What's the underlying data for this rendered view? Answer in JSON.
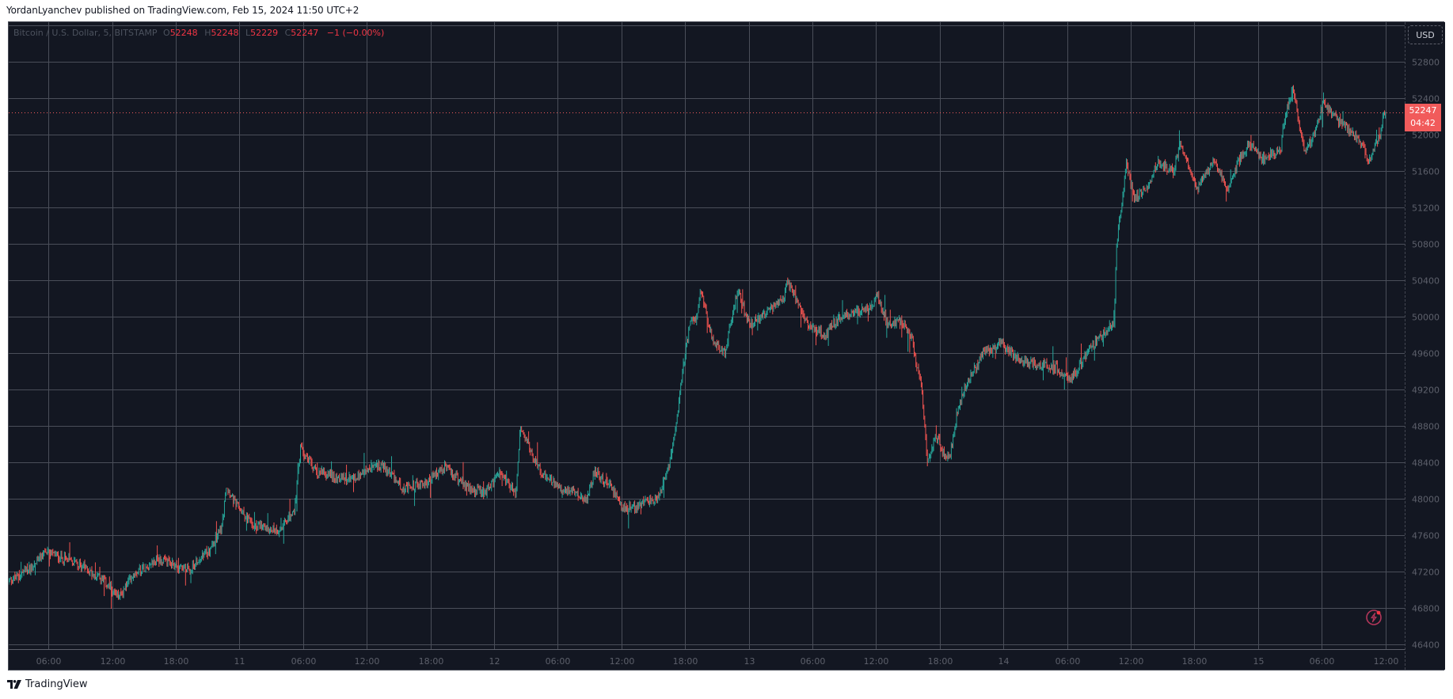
{
  "header": {
    "published_line": "YordanLyanchev published on TradingView.com, Feb 15, 2024 11:50 UTC+2"
  },
  "legend": {
    "symbol": "Bitcoin / U.S. Dollar, 5, BITSTAMP",
    "open_label": "O",
    "open": "52248",
    "high_label": "H",
    "high": "52248",
    "low_label": "L",
    "low": "52229",
    "close_label": "C",
    "close": "52247",
    "change": "−1 (−0.00%)"
  },
  "price_axis": {
    "currency_button": "USD",
    "last_price": "52247",
    "countdown": "04:42"
  },
  "footer": {
    "logo_glyph": "TV",
    "brand": "TradingView"
  },
  "icons": {
    "flash": "lightning-icon"
  },
  "colors": {
    "background": "#131722",
    "grid": "#4a4e59",
    "up": "#26a69a",
    "down": "#ef5350",
    "last_price": "#f15b5b",
    "axis_text": "#5d606b"
  },
  "chart_data": {
    "type": "candlestick",
    "title": "Bitcoin / U.S. Dollar, 5, BITSTAMP",
    "interval_minutes": 5,
    "start_time": "Feb 10 02:15",
    "hours_span": 107.8,
    "ylim": [
      46320,
      53300
    ],
    "y_ticks": [
      46400,
      46800,
      47200,
      47600,
      48000,
      48400,
      48800,
      49200,
      49600,
      50000,
      50400,
      50800,
      51200,
      51600,
      52000,
      52400,
      52800
    ],
    "x_ticks": [
      {
        "label": "06:00",
        "hours": 3.75
      },
      {
        "label": "12:00",
        "hours": 9.75
      },
      {
        "label": "18:00",
        "hours": 15.75
      },
      {
        "label": "11",
        "hours": 21.75
      },
      {
        "label": "06:00",
        "hours": 27.75
      },
      {
        "label": "12:00",
        "hours": 33.75
      },
      {
        "label": "18:00",
        "hours": 39.75
      },
      {
        "label": "12",
        "hours": 45.75
      },
      {
        "label": "06:00",
        "hours": 51.75
      },
      {
        "label": "12:00",
        "hours": 57.75
      },
      {
        "label": "18:00",
        "hours": 63.75
      },
      {
        "label": "13",
        "hours": 69.75
      },
      {
        "label": "06:00",
        "hours": 75.75
      },
      {
        "label": "12:00",
        "hours": 81.75
      },
      {
        "label": "18:00",
        "hours": 87.75
      },
      {
        "label": "14",
        "hours": 93.75
      },
      {
        "label": "06:00",
        "hours": 99.75
      },
      {
        "label": "12:00",
        "hours": 105.75
      },
      {
        "label": "18:00",
        "hours": 111.75
      },
      {
        "label": "15",
        "hours": 117.75
      },
      {
        "label": "06:00",
        "hours": 123.75
      },
      {
        "label": "12:00",
        "hours": 129.75
      }
    ],
    "price_path": [
      [
        0,
        47100
      ],
      [
        1.0,
        47150
      ],
      [
        2.6,
        47300
      ],
      [
        3.4,
        47420
      ],
      [
        6.7,
        47280
      ],
      [
        8.9,
        47100
      ],
      [
        10.4,
        46920
      ],
      [
        11.9,
        47200
      ],
      [
        14.1,
        47330
      ],
      [
        17.1,
        47220
      ],
      [
        19.0,
        47450
      ],
      [
        20.1,
        47700
      ],
      [
        20.5,
        48150
      ],
      [
        21.3,
        47950
      ],
      [
        23.1,
        47700
      ],
      [
        25.4,
        47650
      ],
      [
        26.9,
        47850
      ],
      [
        27.5,
        48550
      ],
      [
        29.1,
        48280
      ],
      [
        32.1,
        48200
      ],
      [
        35.1,
        48380
      ],
      [
        37.3,
        48100
      ],
      [
        39.6,
        48200
      ],
      [
        41.1,
        48350
      ],
      [
        42.9,
        48150
      ],
      [
        44.9,
        48050
      ],
      [
        46.3,
        48300
      ],
      [
        47.8,
        48050
      ],
      [
        48.2,
        48780
      ],
      [
        49.3,
        48500
      ],
      [
        50.4,
        48250
      ],
      [
        52.2,
        48100
      ],
      [
        54.5,
        48000
      ],
      [
        55.2,
        48300
      ],
      [
        56.7,
        48150
      ],
      [
        57.8,
        47900
      ],
      [
        58.6,
        47900
      ],
      [
        59.7,
        47950
      ],
      [
        61.2,
        48000
      ],
      [
        62.3,
        48400
      ],
      [
        63.1,
        49000
      ],
      [
        63.6,
        49500
      ],
      [
        64.2,
        49900
      ],
      [
        64.9,
        50000
      ],
      [
        65.2,
        50300
      ],
      [
        66.4,
        49700
      ],
      [
        67.5,
        49600
      ],
      [
        68.7,
        50300
      ],
      [
        69.8,
        49900
      ],
      [
        70.9,
        50000
      ],
      [
        73.1,
        50200
      ],
      [
        73.3,
        50400
      ],
      [
        75.4,
        49900
      ],
      [
        76.9,
        49800
      ],
      [
        78.4,
        50000
      ],
      [
        81.4,
        50100
      ],
      [
        81.8,
        50250
      ],
      [
        82.9,
        49900
      ],
      [
        84.0,
        49950
      ],
      [
        85.1,
        49800
      ],
      [
        85.5,
        49500
      ],
      [
        86.0,
        49300
      ],
      [
        86.3,
        48800
      ],
      [
        86.6,
        48400
      ],
      [
        87.4,
        48700
      ],
      [
        88.1,
        48500
      ],
      [
        88.7,
        48450
      ],
      [
        89.3,
        48900
      ],
      [
        90.4,
        49300
      ],
      [
        91.9,
        49600
      ],
      [
        93.4,
        49700
      ],
      [
        95.6,
        49500
      ],
      [
        98.6,
        49450
      ],
      [
        100.1,
        49300
      ],
      [
        101.6,
        49600
      ],
      [
        103.1,
        49800
      ],
      [
        104.2,
        49950
      ],
      [
        104.4,
        50800
      ],
      [
        105.0,
        51300
      ],
      [
        105.3,
        51700
      ],
      [
        106.1,
        51300
      ],
      [
        107.2,
        51400
      ],
      [
        108.3,
        51700
      ],
      [
        109.8,
        51600
      ],
      [
        110.4,
        51900
      ],
      [
        111.3,
        51650
      ],
      [
        112.0,
        51400
      ],
      [
        113.5,
        51700
      ],
      [
        115.0,
        51400
      ],
      [
        115.9,
        51700
      ],
      [
        116.9,
        51900
      ],
      [
        118.0,
        51750
      ],
      [
        119.9,
        51800
      ],
      [
        120.1,
        52100
      ],
      [
        120.7,
        52400
      ],
      [
        121.1,
        52500
      ],
      [
        121.8,
        52000
      ],
      [
        122.2,
        51800
      ],
      [
        123.3,
        52100
      ],
      [
        123.9,
        52350
      ],
      [
        124.8,
        52200
      ],
      [
        125.5,
        52150
      ],
      [
        126.3,
        52050
      ],
      [
        127.6,
        51900
      ],
      [
        128.1,
        51700
      ],
      [
        129.3,
        52000
      ],
      [
        129.6,
        52250
      ],
      [
        129.8,
        52247
      ]
    ],
    "last_price": 52247
  }
}
